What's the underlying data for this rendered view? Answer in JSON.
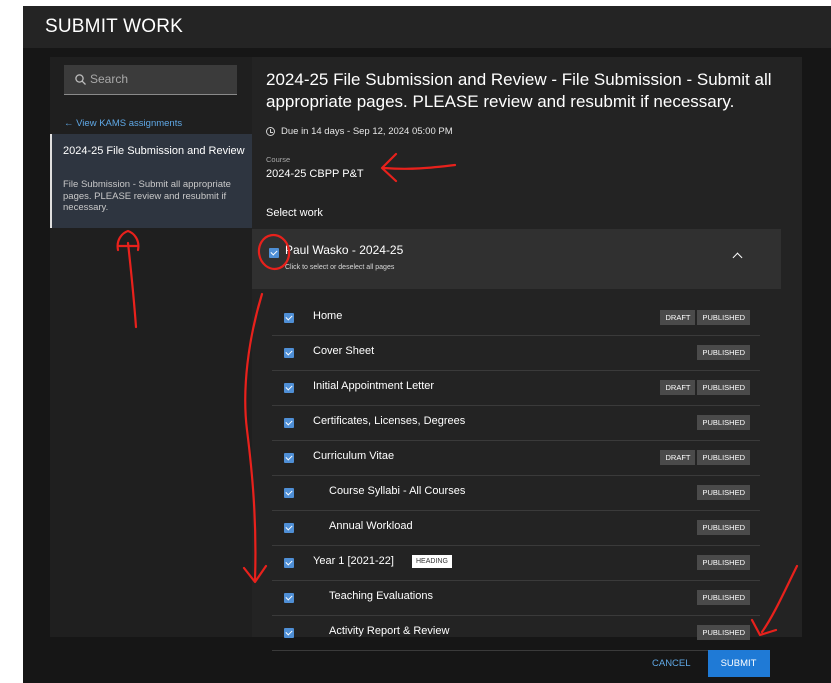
{
  "header": {
    "title": "SUBMIT WORK"
  },
  "sidebar": {
    "search_placeholder": "Search",
    "back_link": "← View KAMS assignments",
    "active_item": {
      "title": "2024-25 File Submission and Review",
      "description": "File Submission - Submit all appropriate pages. PLEASE review and resubmit if necessary."
    }
  },
  "main": {
    "title": "2024-25 File Submission and Review - File Submission - Submit all appropriate pages. PLEASE review and resubmit if necessary.",
    "due": "Due in 14 days - Sep 12, 2024 05:00 PM",
    "course_label": "Course",
    "course_value": "2024-25 CBPP P&T",
    "select_label": "Select work",
    "group": {
      "name": "Paul Wasko - 2024-25",
      "hint": "Click to select or deselect all pages",
      "checked": true,
      "expanded": true
    },
    "pages": [
      {
        "title": "Home",
        "indent": 0,
        "checked": true,
        "badges": [
          "DRAFT",
          "PUBLISHED"
        ]
      },
      {
        "title": "Cover Sheet",
        "indent": 0,
        "checked": true,
        "badges": [
          "PUBLISHED"
        ]
      },
      {
        "title": "Initial Appointment Letter",
        "indent": 0,
        "checked": true,
        "badges": [
          "DRAFT",
          "PUBLISHED"
        ]
      },
      {
        "title": "Certificates, Licenses, Degrees",
        "indent": 0,
        "checked": true,
        "badges": [
          "PUBLISHED"
        ]
      },
      {
        "title": "Curriculum Vitae",
        "indent": 0,
        "checked": true,
        "badges": [
          "DRAFT",
          "PUBLISHED"
        ]
      },
      {
        "title": "Course Syllabi - All Courses",
        "indent": 1,
        "checked": true,
        "badges": [
          "PUBLISHED"
        ]
      },
      {
        "title": "Annual Workload",
        "indent": 1,
        "checked": true,
        "badges": [
          "PUBLISHED"
        ]
      },
      {
        "title": "Year 1 [2021-22]",
        "indent": 0,
        "checked": true,
        "heading_badge": "HEADING",
        "badges": [
          "PUBLISHED"
        ]
      },
      {
        "title": "Teaching Evaluations",
        "indent": 1,
        "checked": true,
        "badges": [
          "PUBLISHED"
        ]
      },
      {
        "title": "Activity Report & Review",
        "indent": 1,
        "checked": true,
        "badges": [
          "PUBLISHED"
        ]
      }
    ]
  },
  "footer": {
    "cancel_label": "CANCEL",
    "submit_label": "SUBMIT"
  },
  "colors": {
    "accent": "#1f7ad6",
    "link": "#5fa8e6",
    "annotation": "#e8211c"
  }
}
